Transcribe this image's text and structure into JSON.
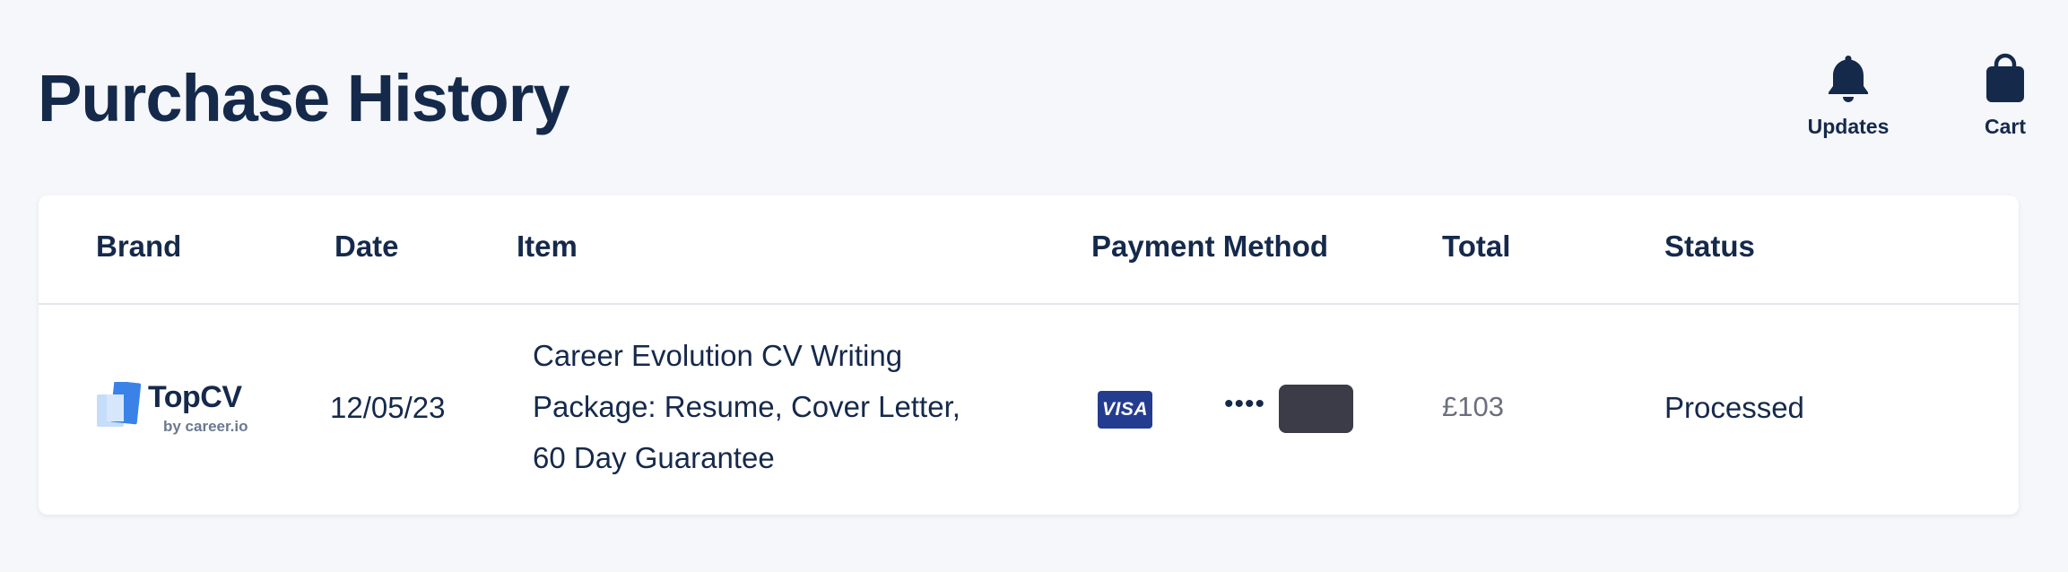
{
  "page": {
    "title": "Purchase History"
  },
  "top_actions": {
    "updates": {
      "label": "Updates",
      "icon": "bell-icon"
    },
    "cart": {
      "label": "Cart",
      "icon": "shopping-bag-icon"
    }
  },
  "table": {
    "columns": {
      "brand": "Brand",
      "date": "Date",
      "item": "Item",
      "payment": "Payment Method",
      "total": "Total",
      "status": "Status"
    },
    "rows": [
      {
        "brand": {
          "name": "TopCV",
          "sub": "by career.io",
          "icon": "topcv-logo-icon"
        },
        "date": "12/05/23",
        "item_lines": [
          "Career Evolution CV Writing",
          "Package: Resume, Cover Letter,",
          "60 Day Guarantee"
        ],
        "payment": {
          "card_brand": "VISA",
          "masked": "••••"
        },
        "total": "£103",
        "status": "Processed"
      }
    ]
  },
  "colors": {
    "background": "#f5f7fb",
    "text": "#15294b",
    "visa": "#243c8f",
    "masked_block": "#3b3c47",
    "total_text": "#6b6f7d"
  }
}
